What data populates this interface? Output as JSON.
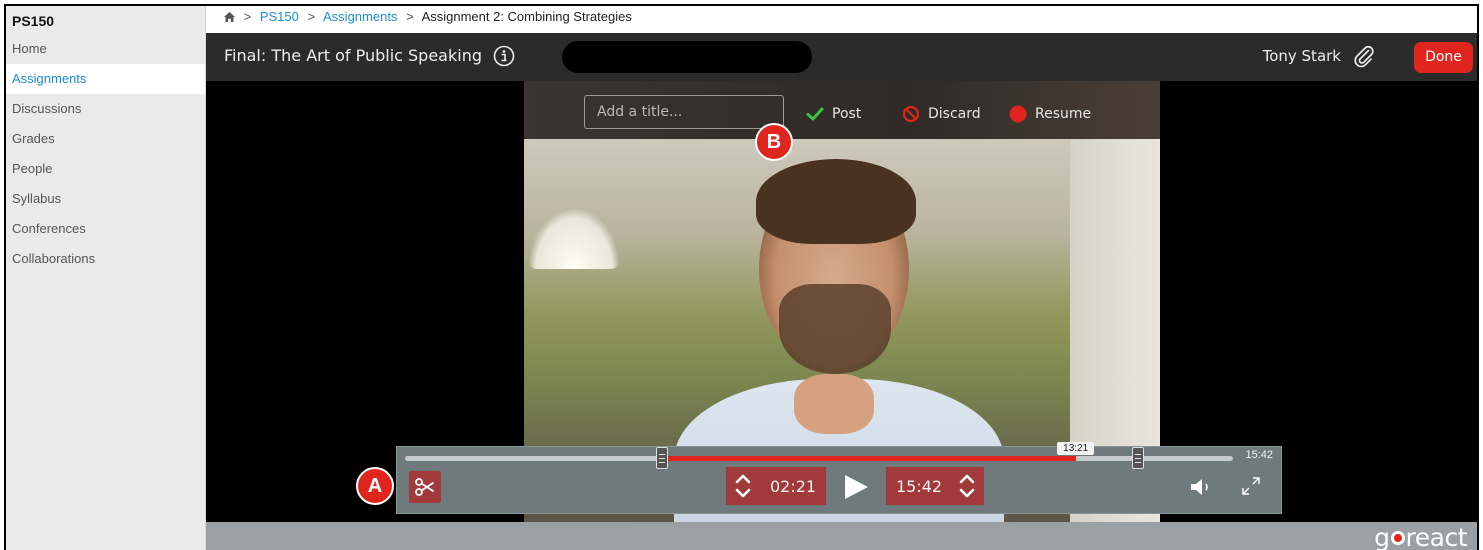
{
  "sidebar": {
    "course_title": "PS150",
    "items": [
      {
        "label": "Home",
        "active": false
      },
      {
        "label": "Assignments",
        "active": true
      },
      {
        "label": "Discussions",
        "active": false
      },
      {
        "label": "Grades",
        "active": false
      },
      {
        "label": "People",
        "active": false
      },
      {
        "label": "Syllabus",
        "active": false
      },
      {
        "label": "Conferences",
        "active": false
      },
      {
        "label": "Collaborations",
        "active": false
      }
    ]
  },
  "breadcrumb": {
    "items": [
      "PS150",
      "Assignments",
      "Assignment 2: Combining Strategies"
    ],
    "separator": ">"
  },
  "player": {
    "title": "Final: The Art of Public Speaking",
    "user_name": "Tony Stark",
    "done_label": "Done",
    "title_placeholder": "Add a title...",
    "post_label": "Post",
    "discard_label": "Discard",
    "resume_label": "Resume",
    "markers": {
      "a": "A",
      "b": "B"
    },
    "timeline": {
      "trim_start_fraction": 0.31,
      "trim_end_fraction": 0.885,
      "playhead_fraction": 0.81,
      "playhead_label": "13:21",
      "total_label": "15:42"
    },
    "start_time": "02:21",
    "end_time": "15:42",
    "logo_left": "g",
    "logo_right": "react"
  },
  "colors": {
    "accent_red": "#e0251f",
    "link_blue": "#1a8cd8",
    "control_red": "#a23a3c",
    "controls_bg": "#6e7a7b"
  },
  "icons": [
    "home-icon",
    "info-icon",
    "paperclip-icon",
    "check-icon",
    "prohibit-icon",
    "record-dot-icon",
    "scissors-icon",
    "chevron-up-down-icon",
    "play-icon",
    "volume-icon",
    "fullscreen-icon"
  ]
}
